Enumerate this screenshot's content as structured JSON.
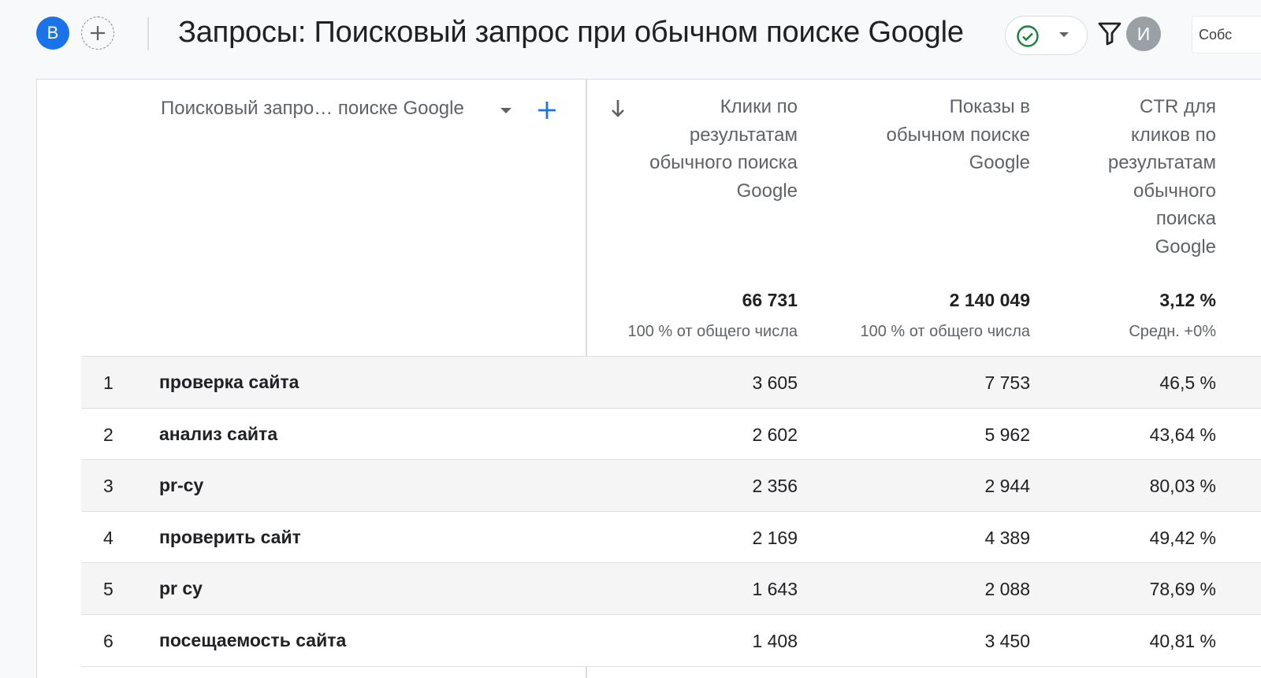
{
  "topbar": {
    "segment_avatar_letter": "B",
    "title": "Запросы: Поисковый запрос при обычном поиске Google",
    "user_avatar_letter": "И",
    "custom_button_label": "Собс"
  },
  "table": {
    "dimension_header": "Поисковый запро… поиске Google",
    "metrics": [
      {
        "header_lines": [
          "Клики по",
          "результатам",
          "обычного поиска",
          "Google"
        ],
        "total": "66 731",
        "total_note": "100 % от общего числа"
      },
      {
        "header_lines": [
          "Показы в",
          "обычном поиске",
          "Google"
        ],
        "total": "2 140 049",
        "total_note": "100 % от общего числа"
      },
      {
        "header_lines": [
          "CTR для",
          "кликов по",
          "результатам",
          "обычного",
          "поиска",
          "Google"
        ],
        "total": "3,12 %",
        "total_note": "Средн. +0%"
      }
    ],
    "rows": [
      {
        "num": "1",
        "query": "проверка сайта",
        "clicks": "3 605",
        "impressions": "7 753",
        "ctr": "46,5 %"
      },
      {
        "num": "2",
        "query": "анализ сайта",
        "clicks": "2 602",
        "impressions": "5 962",
        "ctr": "43,64 %"
      },
      {
        "num": "3",
        "query": "pr-cy",
        "clicks": "2 356",
        "impressions": "2 944",
        "ctr": "80,03 %"
      },
      {
        "num": "4",
        "query": "проверить сайт",
        "clicks": "2 169",
        "impressions": "4 389",
        "ctr": "49,42 %"
      },
      {
        "num": "5",
        "query": "pr cy",
        "clicks": "1 643",
        "impressions": "2 088",
        "ctr": "78,69 %"
      },
      {
        "num": "6",
        "query": "посещаемость сайта",
        "clicks": "1 408",
        "impressions": "3 450",
        "ctr": "40,81 %"
      }
    ]
  },
  "colors": {
    "accent": "#1a73e8",
    "status_ok": "#188038",
    "row_alt": "#f5f5f5"
  },
  "icons": {
    "add_comparison": "plus-circle-dashed-icon",
    "status": "check-circle-icon",
    "filter": "filter-icon",
    "sort": "arrow-down-icon",
    "add_dimension": "plus-icon"
  }
}
